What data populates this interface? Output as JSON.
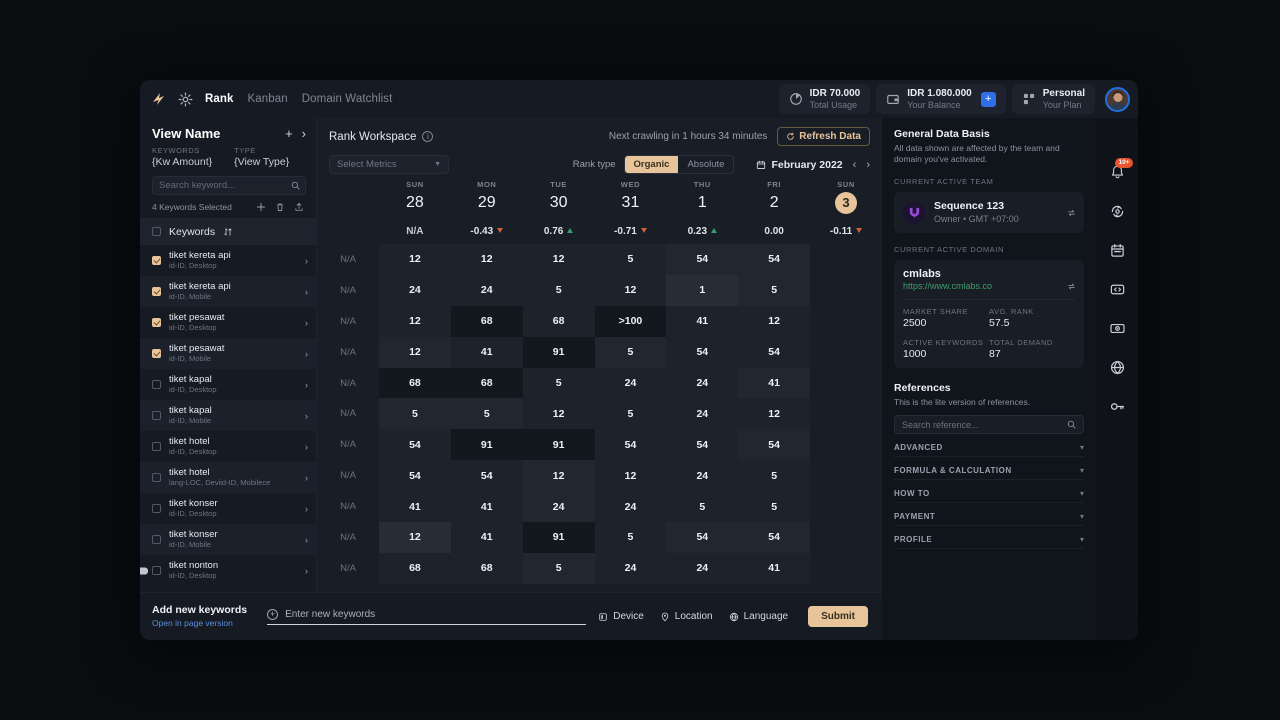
{
  "topbar": {
    "nav": [
      {
        "label": "Rank",
        "active": true
      },
      {
        "label": "Kanban",
        "active": false
      },
      {
        "label": "Domain Watchlist",
        "active": false
      }
    ],
    "stats": [
      {
        "icon": "pie-chart-icon",
        "value": "IDR 70.000",
        "label": "Total Usage"
      },
      {
        "icon": "wallet-icon",
        "value": "IDR 1.080.000",
        "label": "Your Balance",
        "plus": "+"
      },
      {
        "icon": "grid-icon",
        "value": "Personal",
        "label": "Your Plan"
      }
    ]
  },
  "left": {
    "view_name": "View Name",
    "add_label": "+",
    "expand_label": "›",
    "meta": [
      {
        "key": "KEYWORDS",
        "value": "{Kw Amount}"
      },
      {
        "key": "TYPE",
        "value": "{View Type}"
      }
    ],
    "search_placeholder": "Search keyword...",
    "selected_text": "4 Keywords Selected",
    "keywords_header": "Keywords",
    "rows": [
      {
        "name": "tiket kereta api",
        "meta": "id-ID, Desktop",
        "checked": true
      },
      {
        "name": "tiket kereta api",
        "meta": "id-ID, Mobile",
        "checked": true
      },
      {
        "name": "tiket pesawat",
        "meta": "id-ID, Desktop",
        "checked": true
      },
      {
        "name": "tiket pesawat",
        "meta": "id-ID, Mobile",
        "checked": true
      },
      {
        "name": "tiket kapal",
        "meta": "id-ID, Desktop",
        "checked": false
      },
      {
        "name": "tiket kapal",
        "meta": "id-ID, Mobile",
        "checked": false
      },
      {
        "name": "tiket hotel",
        "meta": "id-ID, Desktop",
        "checked": false
      },
      {
        "name": "tiket hotel",
        "meta": "lang-LOC, Deviid-ID, Mobilece",
        "checked": false
      },
      {
        "name": "tiket konser",
        "meta": "id-ID, Desktop",
        "checked": false
      },
      {
        "name": "tiket konser",
        "meta": "id-ID, Mobile",
        "checked": false
      },
      {
        "name": "tiket nonton",
        "meta": "id-ID, Desktop",
        "checked": false
      }
    ]
  },
  "workspace": {
    "title": "Rank Workspace",
    "crawl_text": "Next crawling in 1 hours 34 minutes",
    "refresh_label": "Refresh Data",
    "metrics_placeholder": "Select Metrics",
    "rank_type_label": "Rank type",
    "rank_types": [
      {
        "label": "Organic",
        "active": true
      },
      {
        "label": "Absolute",
        "active": false
      }
    ],
    "month": "February 2022",
    "prev": "‹",
    "next": "›"
  },
  "chart_data": {
    "type": "table",
    "title": "Rank Workspace",
    "columns": [
      {
        "dow": "SUN",
        "day": "28",
        "today": false
      },
      {
        "dow": "MON",
        "day": "29",
        "today": false
      },
      {
        "dow": "TUE",
        "day": "30",
        "today": false
      },
      {
        "dow": "WED",
        "day": "31",
        "today": false
      },
      {
        "dow": "THU",
        "day": "1",
        "today": false
      },
      {
        "dow": "FRI",
        "day": "2",
        "today": false
      },
      {
        "dow": "SUN",
        "day": "3",
        "today": true
      }
    ],
    "delta_row": [
      {
        "value": "N/A",
        "dir": "none"
      },
      {
        "value": "-0.43",
        "dir": "down"
      },
      {
        "value": "0.76",
        "dir": "up"
      },
      {
        "value": "-0.71",
        "dir": "down"
      },
      {
        "value": "0.23",
        "dir": "up"
      },
      {
        "value": "0.00",
        "dir": "none"
      },
      {
        "value": "-0.11",
        "dir": "down"
      }
    ],
    "rows": [
      {
        "cells": [
          "N/A",
          "12",
          "12",
          "12",
          "5",
          "54",
          "54"
        ],
        "shades": [
          0,
          1,
          1,
          1,
          1,
          2,
          2
        ]
      },
      {
        "cells": [
          "N/A",
          "24",
          "24",
          "5",
          "12",
          "1",
          "5"
        ],
        "shades": [
          0,
          1,
          1,
          1,
          1,
          3,
          2
        ]
      },
      {
        "cells": [
          "N/A",
          "12",
          "68",
          "68",
          ">100",
          "41",
          "12"
        ],
        "shades": [
          0,
          1,
          9,
          1,
          9,
          1,
          1
        ]
      },
      {
        "cells": [
          "N/A",
          "12",
          "41",
          "91",
          "5",
          "54",
          "54"
        ],
        "shades": [
          0,
          2,
          1,
          9,
          2,
          1,
          1
        ]
      },
      {
        "cells": [
          "N/A",
          "68",
          "68",
          "5",
          "24",
          "24",
          "41"
        ],
        "shades": [
          0,
          9,
          9,
          1,
          1,
          1,
          2
        ]
      },
      {
        "cells": [
          "N/A",
          "5",
          "5",
          "12",
          "5",
          "24",
          "12"
        ],
        "shades": [
          0,
          2,
          2,
          1,
          1,
          1,
          1
        ]
      },
      {
        "cells": [
          "N/A",
          "54",
          "91",
          "91",
          "54",
          "54",
          "54"
        ],
        "shades": [
          0,
          1,
          9,
          9,
          1,
          1,
          2
        ]
      },
      {
        "cells": [
          "N/A",
          "54",
          "54",
          "12",
          "12",
          "24",
          "5"
        ],
        "shades": [
          0,
          1,
          1,
          2,
          1,
          1,
          1
        ]
      },
      {
        "cells": [
          "N/A",
          "41",
          "41",
          "24",
          "24",
          "5",
          "5"
        ],
        "shades": [
          0,
          1,
          1,
          2,
          1,
          1,
          1
        ]
      },
      {
        "cells": [
          "N/A",
          "12",
          "41",
          "91",
          "5",
          "54",
          "54"
        ],
        "shades": [
          0,
          3,
          1,
          9,
          1,
          2,
          2
        ]
      },
      {
        "cells": [
          "N/A",
          "68",
          "68",
          "5",
          "24",
          "24",
          "41"
        ],
        "shades": [
          0,
          1,
          1,
          2,
          1,
          1,
          1
        ]
      }
    ]
  },
  "bottom": {
    "add_title": "Add new keywords",
    "add_link": "Open in page version",
    "input_placeholder": "Enter new keywords",
    "options": [
      {
        "label": "Device",
        "icon": "device-icon"
      },
      {
        "label": "Location",
        "icon": "location-icon"
      },
      {
        "label": "Language",
        "icon": "globe-icon"
      }
    ],
    "submit_label": "Submit"
  },
  "right": {
    "title": "General Data Basis",
    "subtitle": "All data shown are affected by the team and domain you've activated.",
    "team_label": "CURRENT ACTIVE TEAM",
    "team_name": "Sequence 123",
    "team_meta": "Owner • GMT +07:00",
    "domain_label": "CURRENT ACTIVE DOMAIN",
    "domain_name": "cmlabs",
    "domain_url": "https://www.cmlabs.co",
    "stats": [
      {
        "key": "MARKET SHARE",
        "value": "2500"
      },
      {
        "key": "AVG. RANK",
        "value": "57.5"
      },
      {
        "key": "ACTIVE KEYWORDS",
        "value": "1000"
      },
      {
        "key": "TOTAL DEMAND",
        "value": "87"
      }
    ],
    "ref_title": "References",
    "ref_subtitle": "This is the lite version of references.",
    "ref_placeholder": "Search reference...",
    "accordions": [
      "ADVANCED",
      "FORMULA & CALCULATION",
      "HOW TO",
      "PAYMENT",
      "PROFILE"
    ]
  },
  "rail": {
    "items": [
      {
        "icon": "bell-icon",
        "badge": "10+"
      },
      {
        "icon": "sync-icon",
        "badge": ""
      },
      {
        "icon": "calendar-icon",
        "badge": ""
      },
      {
        "icon": "code-icon",
        "badge": ""
      },
      {
        "icon": "money-icon",
        "badge": ""
      },
      {
        "icon": "globe-icon",
        "badge": ""
      },
      {
        "icon": "key-icon",
        "badge": ""
      }
    ]
  }
}
